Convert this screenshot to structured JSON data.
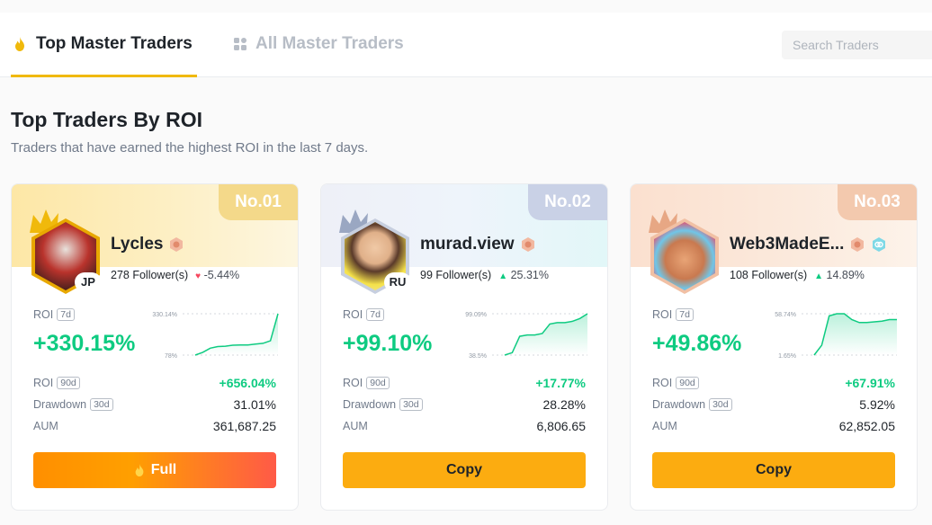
{
  "tabs": [
    {
      "label": "Top Master Traders",
      "icon": "flame-icon",
      "active": true
    },
    {
      "label": "All Master Traders",
      "icon": "grid-icon",
      "active": false
    }
  ],
  "search": {
    "placeholder": "Search Traders"
  },
  "section": {
    "title": "Top Traders By ROI",
    "subtitle": "Traders that have earned the highest ROI in the last 7 days."
  },
  "labels": {
    "roi": "ROI",
    "period_7d": "7d",
    "period_90d": "90d",
    "drawdown": "Drawdown",
    "period_30d": "30d",
    "aum": "AUM"
  },
  "traders": [
    {
      "rank": "No.01",
      "name": "Lycles",
      "country": "JP",
      "followers": "278 Follower(s)",
      "follower_change": "-5.44%",
      "follower_trend": "down",
      "roi_7d": "+330.15%",
      "spark_max": "330.14%",
      "spark_min": "78%",
      "spark_values": [
        78,
        95,
        120,
        130,
        132,
        138,
        140,
        140,
        145,
        150,
        165,
        330
      ],
      "roi_90d": "+656.04%",
      "drawdown_30d": "31.01%",
      "aum": "361,687.25",
      "button": "Full",
      "button_type": "full"
    },
    {
      "rank": "No.02",
      "name": "murad.view",
      "country": "RU",
      "followers": "99 Follower(s)",
      "follower_change": "25.31%",
      "follower_trend": "up",
      "roi_7d": "+99.10%",
      "spark_max": "99.09%",
      "spark_min": "38.5%",
      "spark_values": [
        38.5,
        42,
        66,
        68,
        68,
        70,
        84,
        86,
        86,
        88,
        92,
        99
      ],
      "roi_90d": "+17.77%",
      "drawdown_30d": "28.28%",
      "aum": "6,806.65",
      "button": "Copy",
      "button_type": "copy"
    },
    {
      "rank": "No.03",
      "name": "Web3MadeE...",
      "country": "",
      "followers": "108 Follower(s)",
      "follower_change": "14.89%",
      "follower_trend": "up",
      "roi_7d": "+49.86%",
      "spark_max": "58.74%",
      "spark_min": "1.65%",
      "spark_values": [
        1.65,
        15,
        55,
        58,
        58,
        50,
        46,
        46,
        47,
        48,
        50,
        50
      ],
      "roi_90d": "+67.91%",
      "drawdown_30d": "5.92%",
      "aum": "62,852.05",
      "button": "Copy",
      "button_type": "copy"
    }
  ],
  "colors": {
    "accent": "#f0b90b",
    "green": "#0ecb81",
    "red": "#f6465d",
    "copy_button": "#fcac10"
  }
}
